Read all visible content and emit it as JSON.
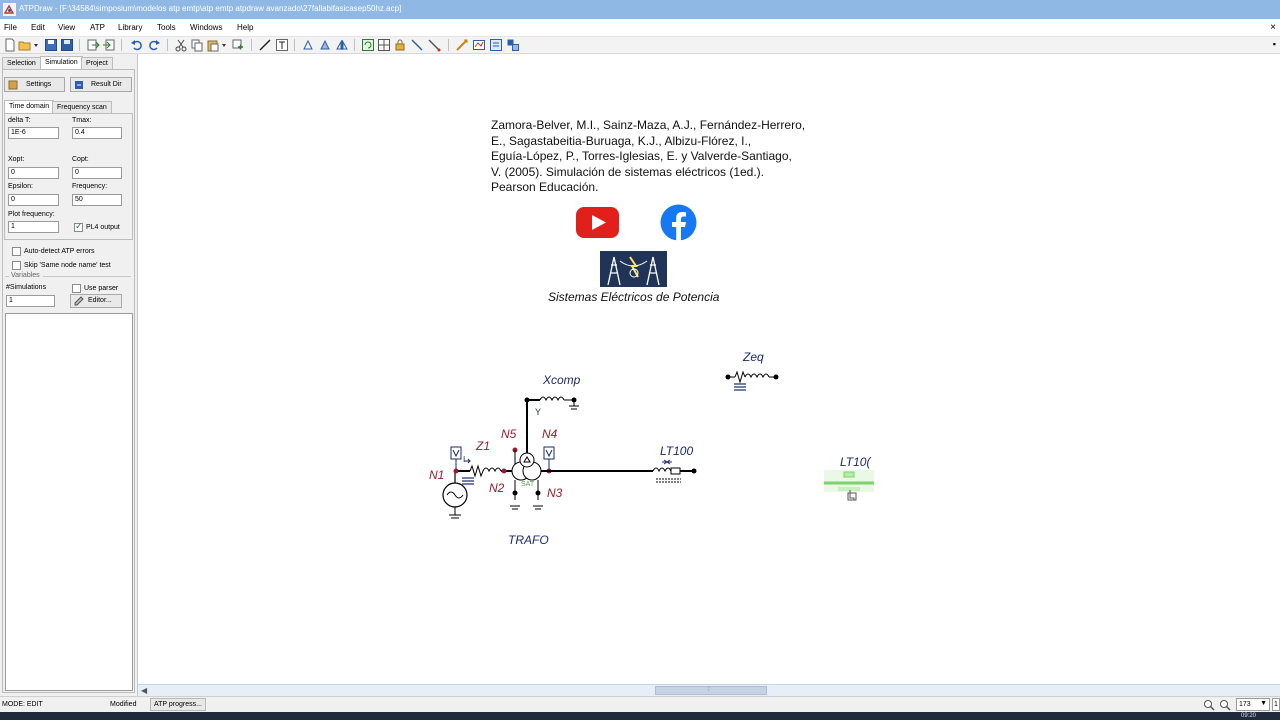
{
  "window": {
    "title": "ATPDraw - [F:\\34584\\simposium\\modelos atp emtp\\atp emtp atpdraw avanzado\\27fallabifasicasep50hz.acp]"
  },
  "menu": {
    "items": [
      "File",
      "Edit",
      "View",
      "ATP",
      "Library",
      "Tools",
      "Windows",
      "Help"
    ],
    "close_glyph": "×"
  },
  "left_panel": {
    "top_tabs": [
      "Selection",
      "Simulation",
      "Project"
    ],
    "active_top_tab": "Simulation",
    "settings_label": "Settings",
    "result_dir_label": "Result Dir",
    "sub_tabs": [
      "Time domain",
      "Frequency scan"
    ],
    "active_sub_tab": "Time domain",
    "fields": {
      "delta_t": {
        "label": "delta T:",
        "value": "1E-6"
      },
      "tmax": {
        "label": "Tmax:",
        "value": "0.4"
      },
      "xopt": {
        "label": "Xopt:",
        "value": "0"
      },
      "copt": {
        "label": "Copt:",
        "value": "0"
      },
      "epsilon": {
        "label": "Epsilon:",
        "value": "0"
      },
      "frequency": {
        "label": "Frequency:",
        "value": "50"
      },
      "plot_frequency": {
        "label": "Plot frequency:",
        "value": "1"
      },
      "simulations": {
        "label": "#Simulations",
        "value": "1"
      }
    },
    "pl4_output": {
      "label": "PL4 output",
      "checked": true
    },
    "auto_detect": {
      "label": "Auto-detect ATP errors",
      "checked": false
    },
    "skip_same_node": {
      "label": "Skip 'Same node name' test",
      "checked": false
    },
    "variables_group": "Variables",
    "use_parser": {
      "label": "Use parser",
      "checked": false
    },
    "editor_label": "Editor..."
  },
  "canvas": {
    "reference_lines": [
      "Zamora-Belver, M.I., Sainz-Maza, A.J., Fernández-Herrero,",
      "E., Sagastabeitia-Buruaga, K.J., Albizu-Flórez, I.,",
      "Eguía-López, P., Torres-Iglesias, E. y Valverde-Santiago,",
      "V. (2005). Simulación de sistemas eléctricos (1ed.).",
      "Pearson Educación."
    ],
    "social_icons": [
      "youtube-icon",
      "facebook-icon"
    ],
    "sep_caption": "Sistemas Eléctricos de Potencia",
    "labels": {
      "xcomp": "Xcomp",
      "zeq": "Zeq",
      "n5": "N5",
      "n4": "N4",
      "z1": "Z1",
      "n1": "N1",
      "n2": "N2",
      "n3": "N3",
      "lt100_a": "LT100",
      "lt100_b": "LT10(",
      "trafo": "TRAFO",
      "y_mark": "Y",
      "sat_mark": "SAT",
      "i_mark": "I",
      "v_mark": "V"
    }
  },
  "status_bar": {
    "mode": "MODE: EDIT",
    "modified": "Modified",
    "atp_progress": "ATP progress...",
    "zoom": "173",
    "zoom_extra": "1"
  },
  "taskbar": {
    "clock": "09:20"
  },
  "colors": {
    "titlebar": "#8fb9e4",
    "youtube": "#e1201b",
    "facebook": "#1877f2",
    "wire": "#000000",
    "node_red": "#9b1b2c",
    "node_blue": "#1b2a6b",
    "selected_green": "#7ad46a"
  }
}
